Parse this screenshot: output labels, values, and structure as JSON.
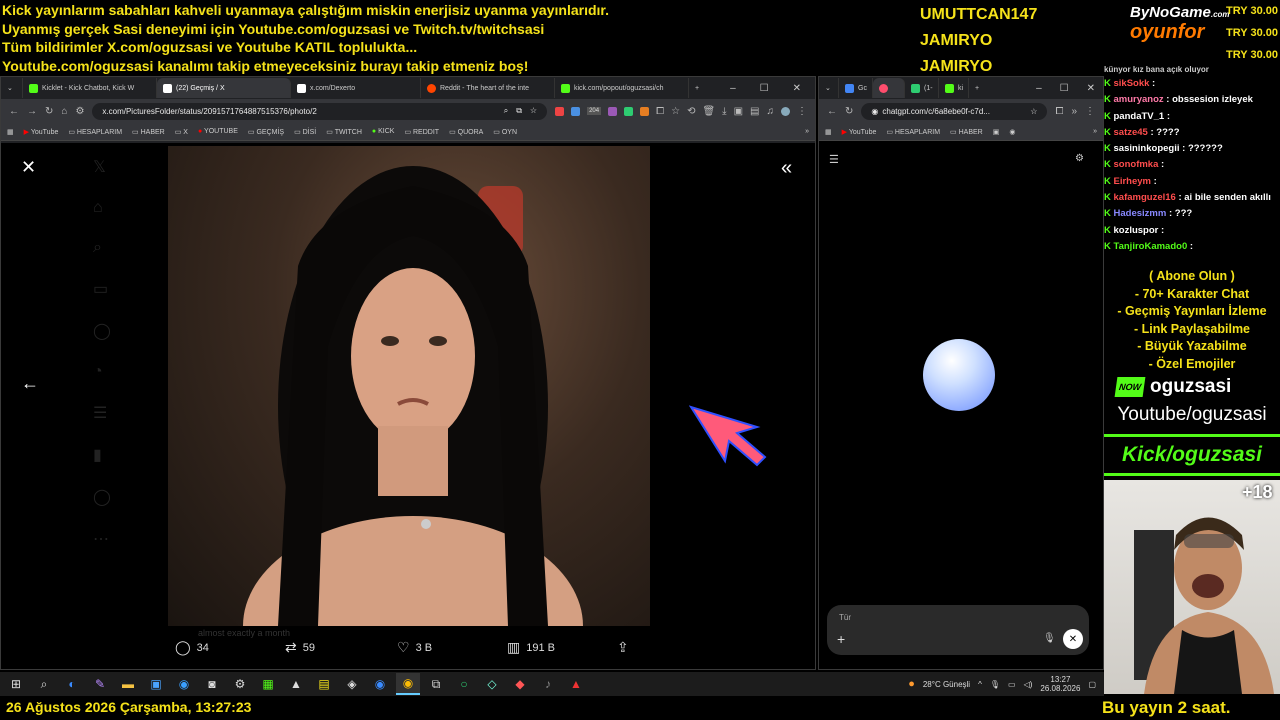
{
  "banner": {
    "lines": [
      "Kick yayınlarım sabahları kahveli uyanmaya çalıştığım miskin enerjisiz uyanma yayınlarıdır.",
      "Uyanmış gerçek Sasi deneyimi için Youtube.com/oguzsasi ve Twitch.tv/twitchsasi",
      "Tüm bildirimler X.com/oguzsasi ve Youtube KATIL toplulukta...",
      "Youtube.com/oguzsasi kanalımı takip etmeyeceksiniz burayı takip etmeniz boş!"
    ]
  },
  "donors": [
    "UMUTTCAN147",
    "JAMIRYO",
    "JAMIRYO"
  ],
  "sponsor": {
    "top": "ByNoGame",
    "top_small": ".com",
    "bottom": "oyunfor"
  },
  "prices": [
    "TRY 30.00",
    "TRY 30.00",
    "TRY 30.00"
  ],
  "left_browser": {
    "tabs": [
      "Kicklet - Kick Chatbot, Kick W",
      "(22) Geçmiş / X",
      "x.com/Dexerto",
      "Reddit - The heart of the inte",
      "kick.com/popout/oguzsasi/ch"
    ],
    "url": "x.com/PicturesFolder/status/2091571764887515376/photo/2",
    "badge": "204",
    "bookmarks": [
      "YouTube",
      "HESAPLARIM",
      "HABER",
      "X",
      "YOUTUBE",
      "GEÇMİŞ",
      "DİSİ",
      "TWITCH",
      "KICK",
      "REDDIT",
      "QUORA",
      "OYN"
    ],
    "actions": {
      "replies": "34",
      "reposts": "59",
      "likes": "3 B",
      "views": "191 B"
    },
    "caption": "almost exactly a month"
  },
  "right_browser": {
    "tabs": [
      "Gc",
      "",
      "(1-",
      "ki"
    ],
    "url": "chatgpt.com/c/6a8ebe0f-c7d...",
    "bookmarks": [
      "YouTube",
      "HESAPLARIM",
      "HABER"
    ],
    "input_placeholder": "Tür"
  },
  "chat": [
    {
      "user": "",
      "msg": "künyor kız bana açık oluyor",
      "color": "#ffffff"
    },
    {
      "user": "sikSokk",
      "msg": "",
      "color": "#ff4d4d"
    },
    {
      "user": "amuryanoz",
      "msg": "obssesion izleyek",
      "color": "#ff7aa8"
    },
    {
      "user": "pandaTV_1",
      "msg": "",
      "color": "#ffffff"
    },
    {
      "user": "satze45",
      "msg": "????",
      "color": "#ff4d4d"
    },
    {
      "user": "sasininkopegii",
      "msg": "??????",
      "color": "#ffffff"
    },
    {
      "user": "sonofmka",
      "msg": "",
      "color": "#ff4d4d"
    },
    {
      "user": "Eirheym",
      "msg": "",
      "color": "#ff4d4d"
    },
    {
      "user": "kafamguzel16",
      "msg": "ai bile senden akıllı",
      "color": "#ff4d4d"
    },
    {
      "user": "Hadesizmm",
      "msg": "???",
      "color": "#8888ff"
    },
    {
      "user": "kozluspor",
      "msg": "",
      "color": "#ffffff"
    },
    {
      "user": "TanjiroKamado0",
      "msg": "",
      "color": "#53fc18"
    }
  ],
  "promo": [
    "( Abone Olun )",
    "- 70+ Karakter Chat",
    "- Geçmiş Yayınları İzleme",
    "- Link Paylaşabilme",
    "- Büyük Yazabilme",
    "- Özel Emojiler"
  ],
  "channel": {
    "now": "NOW",
    "name": "oguzsasi",
    "youtube": "Youtube/oguzsasi",
    "kick": "Kick/oguzsasi"
  },
  "age": "+18",
  "taskbar": {
    "weather": "28°C Güneşli",
    "time": "13:27",
    "date": "26.08.2026"
  },
  "bottom": {
    "datetime": "26 Ağustos 2026 Çarşamba, 13:27:23",
    "ticker": "Bu yayın 2 saat."
  },
  "colors": {
    "yellow": "#f5e21a",
    "kick_green": "#53fc18",
    "orange": "#ff7a00"
  }
}
